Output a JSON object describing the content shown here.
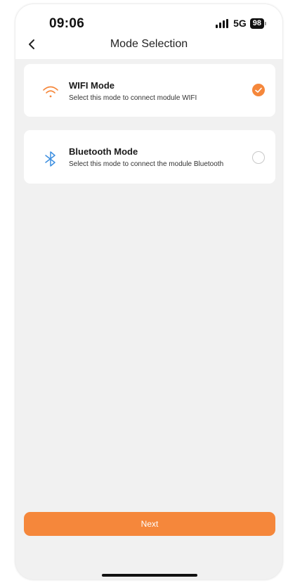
{
  "status_bar": {
    "time": "09:06",
    "network": "5G",
    "battery": "98"
  },
  "header": {
    "title": "Mode Selection",
    "back_icon": "chevron-left-icon"
  },
  "modes": [
    {
      "title": "WIFI Mode",
      "description": "Select this mode to connect module WIFI",
      "icon": "wifi-icon",
      "selected": true
    },
    {
      "title": "Bluetooth Mode",
      "description": "Select this mode to connect the module Bluetooth",
      "icon": "bluetooth-icon",
      "selected": false
    }
  ],
  "footer": {
    "next_label": "Next"
  },
  "colors": {
    "accent": "#f5873b",
    "bluetooth": "#3d8fe0",
    "background": "#f1f1f1"
  }
}
